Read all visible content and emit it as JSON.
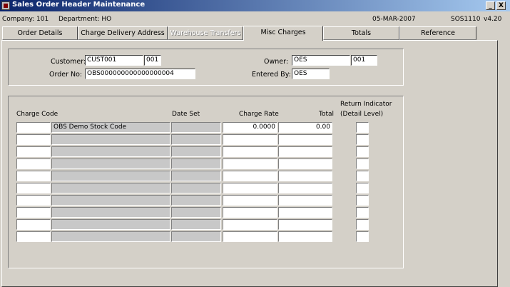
{
  "window": {
    "title": "Sales Order Header Maintenance",
    "minimize_label": "_",
    "close_label": "X"
  },
  "info": {
    "company": "Company: 101",
    "department": "Department: HO",
    "date": "05-MAR-2007",
    "form_id": "SOS1110",
    "version": "v4.20"
  },
  "tabs": [
    {
      "label": "Order Details",
      "state": "normal"
    },
    {
      "label": "Charge Delivery Address",
      "state": "normal"
    },
    {
      "label": "Warehouse Transfers",
      "state": "disabled"
    },
    {
      "label": "Misc Charges",
      "state": "active"
    },
    {
      "label": "Totals",
      "state": "normal"
    },
    {
      "label": "Reference",
      "state": "normal"
    }
  ],
  "header": {
    "customer_label": "Customer:",
    "customer_code": "CUST001",
    "customer_branch": "001",
    "order_no_label": "Order No:",
    "order_no": "OBS000000000000000004",
    "owner_label": "Owner:",
    "owner_code": "OES",
    "owner_branch": "001",
    "entered_by_label": "Entered By:",
    "entered_by": "OES"
  },
  "grid": {
    "columns": {
      "charge_code": "Charge Code",
      "date_set": "Date Set",
      "charge_rate": "Charge Rate",
      "total": "Total",
      "return_indicator_line1": "Return Indicator",
      "return_indicator_line2": "(Detail Level)"
    },
    "rows": [
      {
        "code": "",
        "description": "OBS Demo Stock Code",
        "date_set": "",
        "rate": "0.0000",
        "total": "0.00",
        "ret": ""
      },
      {
        "code": "",
        "description": "",
        "date_set": "",
        "rate": "",
        "total": "",
        "ret": ""
      },
      {
        "code": "",
        "description": "",
        "date_set": "",
        "rate": "",
        "total": "",
        "ret": ""
      },
      {
        "code": "",
        "description": "",
        "date_set": "",
        "rate": "",
        "total": "",
        "ret": ""
      },
      {
        "code": "",
        "description": "",
        "date_set": "",
        "rate": "",
        "total": "",
        "ret": ""
      },
      {
        "code": "",
        "description": "",
        "date_set": "",
        "rate": "",
        "total": "",
        "ret": ""
      },
      {
        "code": "",
        "description": "",
        "date_set": "",
        "rate": "",
        "total": "",
        "ret": ""
      },
      {
        "code": "",
        "description": "",
        "date_set": "",
        "rate": "",
        "total": "",
        "ret": ""
      },
      {
        "code": "",
        "description": "",
        "date_set": "",
        "rate": "",
        "total": "",
        "ret": ""
      },
      {
        "code": "",
        "description": "",
        "date_set": "",
        "rate": "",
        "total": "",
        "ret": ""
      }
    ]
  }
}
